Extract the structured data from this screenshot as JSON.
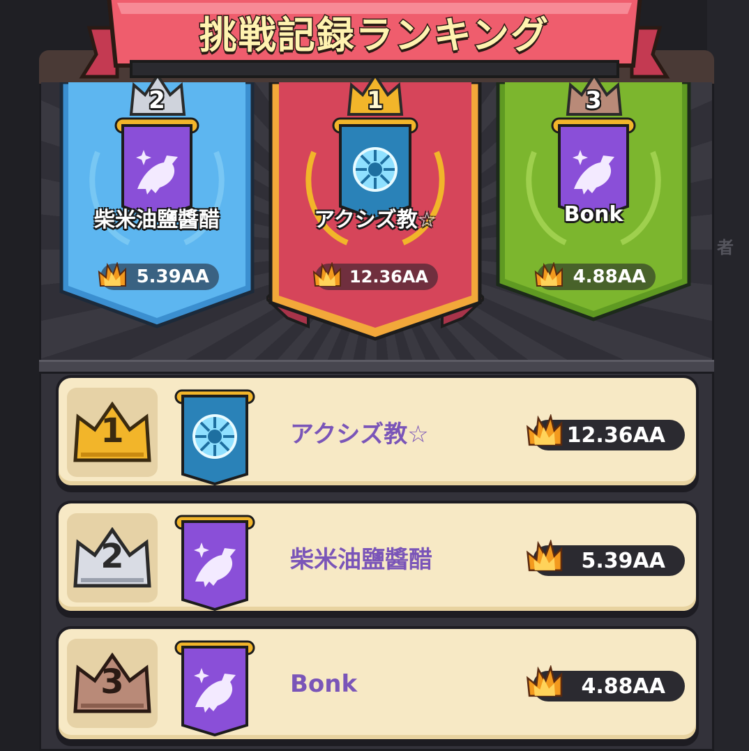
{
  "title": "挑戦記録ランキング",
  "side_text": "者",
  "podium": [
    {
      "rank": "2",
      "name": "柴米油鹽醬醋",
      "score": "5.39AA",
      "emblem": "crow-icon",
      "banner_color": "#4aa7e6"
    },
    {
      "rank": "1",
      "name": "アクシズ教☆",
      "score": "12.36AA",
      "emblem": "water-gem-icon",
      "banner_color": "#d6455a"
    },
    {
      "rank": "3",
      "name": "Bonk",
      "score": "4.88AA",
      "emblem": "crow-icon",
      "banner_color": "#7cb62e"
    }
  ],
  "list": [
    {
      "rank": "1",
      "name": "アクシズ教☆",
      "score": "12.36AA",
      "emblem": "water-gem-icon"
    },
    {
      "rank": "2",
      "name": "柴米油鹽醬醋",
      "score": "5.39AA",
      "emblem": "crow-icon"
    },
    {
      "rank": "3",
      "name": "Bonk",
      "score": "4.88AA",
      "emblem": "crow-icon"
    }
  ],
  "colors": {
    "gold": "#f2b52a",
    "silver": "#cfd3dc",
    "bronze": "#b98a78",
    "purple": "#7a55b8",
    "title_ribbon": "#ef5d6d"
  }
}
